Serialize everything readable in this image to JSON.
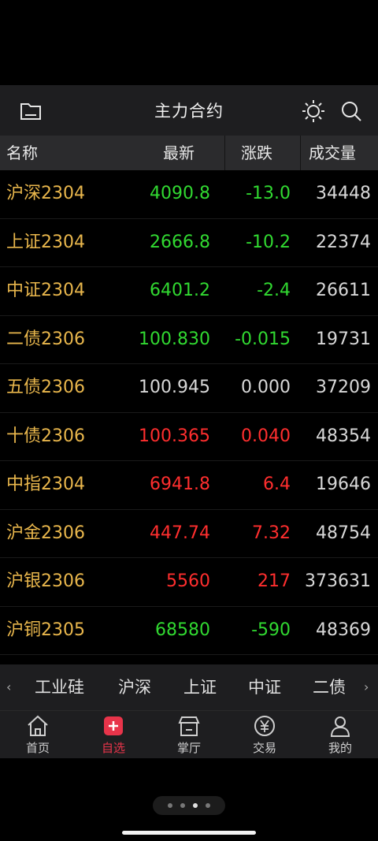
{
  "header": {
    "title": "主力合约",
    "icons": [
      "folder-icon",
      "brightness-icon",
      "search-icon"
    ]
  },
  "columns": {
    "name": "名称",
    "price": "最新",
    "change": "涨跌",
    "volume": "成交量"
  },
  "rows": [
    {
      "name": "沪深2304",
      "price": "4090.8",
      "change": "-13.0",
      "volume": "34448",
      "trend": "down"
    },
    {
      "name": "上证2304",
      "price": "2666.8",
      "change": "-10.2",
      "volume": "22374",
      "trend": "down"
    },
    {
      "name": "中证2304",
      "price": "6401.2",
      "change": "-2.4",
      "volume": "26611",
      "trend": "down"
    },
    {
      "name": "二债2306",
      "price": "100.830",
      "change": "-0.015",
      "volume": "19731",
      "trend": "down"
    },
    {
      "name": "五债2306",
      "price": "100.945",
      "change": "0.000",
      "volume": "37209",
      "trend": "flat"
    },
    {
      "name": "十债2306",
      "price": "100.365",
      "change": "0.040",
      "volume": "48354",
      "trend": "up"
    },
    {
      "name": "中指2304",
      "price": "6941.8",
      "change": "6.4",
      "volume": "19646",
      "trend": "up"
    },
    {
      "name": "沪金2306",
      "price": "447.74",
      "change": "7.32",
      "volume": "48754",
      "trend": "up"
    },
    {
      "name": "沪银2306",
      "price": "5560",
      "change": "217",
      "volume": "373631",
      "trend": "up"
    },
    {
      "name": "沪铜2305",
      "price": "68580",
      "change": "-590",
      "volume": "48369",
      "trend": "down"
    }
  ],
  "tabs": {
    "left_arrow": "‹",
    "right_arrow": "›",
    "items": [
      "工业硅",
      "沪深",
      "上证",
      "中证",
      "二债"
    ]
  },
  "nav": [
    {
      "label": "首页",
      "icon": "home-icon"
    },
    {
      "label": "自选",
      "icon": "watchlist-add-icon",
      "active": true
    },
    {
      "label": "掌厅",
      "icon": "hall-icon"
    },
    {
      "label": "交易",
      "icon": "yen-trade-icon"
    },
    {
      "label": "我的",
      "icon": "profile-icon"
    }
  ],
  "pager": {
    "pages": 4,
    "current": 3
  },
  "colors": {
    "up": "#ff2e2e",
    "down": "#31d931",
    "name": "#e8b64c",
    "active": "#e8344a"
  }
}
